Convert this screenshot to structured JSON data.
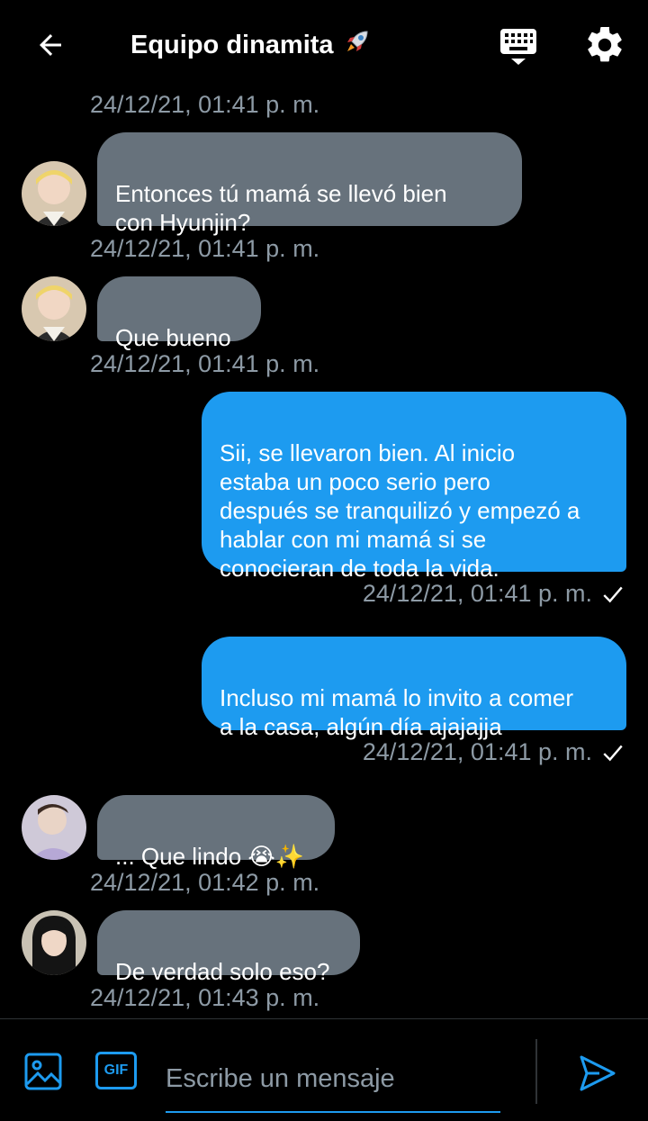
{
  "header": {
    "title": "Equipo dinamita",
    "title_emoji": "🚀",
    "back_icon": "arrow-left-icon",
    "keyboard_icon": "keyboard-icon",
    "settings_icon": "gear-icon"
  },
  "messages": [
    {
      "id": "m0",
      "timestamp": "24/12/21, 01:41 p. m."
    },
    {
      "id": "m1",
      "direction": "in",
      "text": "Entonces tú mamá se llevó bien\ncon Hyunjin?",
      "timestamp": "24/12/21, 01:41 p. m."
    },
    {
      "id": "m2",
      "direction": "in",
      "text": "Que bueno",
      "timestamp": "24/12/21, 01:41 p. m."
    },
    {
      "id": "m3",
      "direction": "out",
      "text": "Sii, se llevaron bien. Al inicio\nestaba un poco serio pero\ndespués se tranquilizó y empezó a\nhablar con mi mamá si se\nconocieran de toda la vida.",
      "timestamp": "24/12/21, 01:41 p. m.",
      "status_icon": "check-icon"
    },
    {
      "id": "m4",
      "direction": "out",
      "text": "Incluso mi mamá lo invito a comer\na la casa, algún día ajajajja",
      "timestamp": "24/12/21, 01:41 p. m.",
      "status_icon": "check-icon"
    },
    {
      "id": "m5",
      "direction": "in",
      "text": "... Que lindo 😭✨",
      "timestamp": "24/12/21, 01:42 p. m."
    },
    {
      "id": "m6",
      "direction": "in",
      "text": "De verdad solo eso?",
      "timestamp": "24/12/21, 01:43 p. m."
    }
  ],
  "composer": {
    "placeholder": "Escribe un mensaje",
    "gif_label": "GIF",
    "image_icon": "image-icon",
    "send_icon": "send-icon"
  },
  "colors": {
    "background": "#000000",
    "accent": "#1d9bf0",
    "incoming_bubble": "#67727c",
    "timestamp": "#8d9aa5"
  }
}
